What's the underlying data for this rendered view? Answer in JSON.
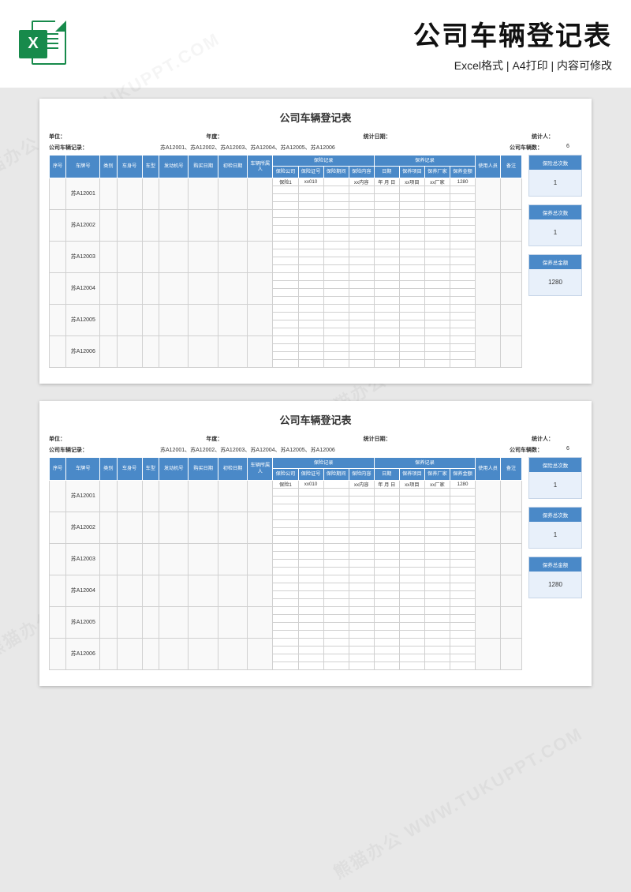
{
  "header": {
    "title": "公司车辆登记表",
    "subtitle": "Excel格式 | A4打印 | 内容可修改"
  },
  "sheet": {
    "title": "公司车辆登记表",
    "metaLabels": {
      "unit": "单位：",
      "year": "年度：",
      "statDate": "统计日期：",
      "statBy": "统计人：",
      "record": "公司车辆记录：",
      "count": "公司车辆数：",
      "countVal": "6"
    },
    "plateList": "苏A12001、苏A12002、苏A12003、苏A12004、苏A12005、苏A12006",
    "columns": {
      "c1": "序号",
      "c2": "车牌号",
      "c3": "类别",
      "c4": "车身号",
      "c5": "车型",
      "c6": "发动机号",
      "c7": "购买日期",
      "c8": "初检日期",
      "c9": "车辆所属人",
      "g1": "保险记录",
      "g1a": "保险公司",
      "g1b": "保险证号",
      "g1c": "保险期间",
      "g1d": "保险内容",
      "g2": "保养记录",
      "g2a": "日期",
      "g2b": "保养项目",
      "g2c": "保养厂家",
      "g2d": "保养金额",
      "c10": "使用人员",
      "c11": "备注"
    },
    "plates": [
      "苏A12001",
      "苏A12002",
      "苏A12003",
      "苏A12004",
      "苏A12005",
      "苏A12006"
    ],
    "sample": {
      "ins": "保险1",
      "cert": "xx010",
      "content": "xx内容",
      "date": "年 月 日",
      "item": "xx项目",
      "factory": "xx厂家",
      "amount": "1280"
    },
    "summary": [
      {
        "h": "保险总次数",
        "v": "1"
      },
      {
        "h": "保养总次数",
        "v": "1"
      },
      {
        "h": "保养总金额",
        "v": "1280"
      }
    ]
  },
  "watermark": "熊猫办公 WWW.TUKUPPT.COM"
}
